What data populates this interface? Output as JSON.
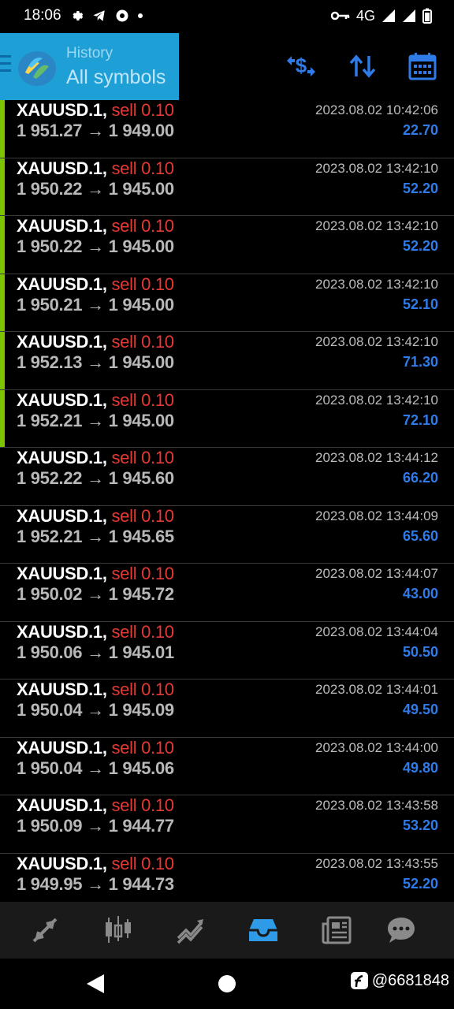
{
  "status_bar": {
    "time": "18:06",
    "network": "4G",
    "icons": [
      "gear-icon",
      "telegram-icon",
      "app-icon",
      "dot-icon",
      "key-icon",
      "signal-icon",
      "battery-icon"
    ]
  },
  "header": {
    "title": "History",
    "subtitle": "All symbols",
    "accent_color": "#1e9fd6"
  },
  "toolbar": {
    "buttons": [
      "currency-exchange-icon",
      "sort-icon",
      "calendar-icon"
    ],
    "icon_color": "#2f7be8"
  },
  "trades": [
    {
      "symbol": "XAUUSD.1,",
      "type": "sell 0.10",
      "open": "1 951.27",
      "close": "1 949.00",
      "time": "2023.08.02 10:42:06",
      "profit": "22.70",
      "accent": true
    },
    {
      "symbol": "XAUUSD.1,",
      "type": "sell 0.10",
      "open": "1 950.22",
      "close": "1 945.00",
      "time": "2023.08.02 13:42:10",
      "profit": "52.20",
      "accent": true
    },
    {
      "symbol": "XAUUSD.1,",
      "type": "sell 0.10",
      "open": "1 950.22",
      "close": "1 945.00",
      "time": "2023.08.02 13:42:10",
      "profit": "52.20",
      "accent": true
    },
    {
      "symbol": "XAUUSD.1,",
      "type": "sell 0.10",
      "open": "1 950.21",
      "close": "1 945.00",
      "time": "2023.08.02 13:42:10",
      "profit": "52.10",
      "accent": true
    },
    {
      "symbol": "XAUUSD.1,",
      "type": "sell 0.10",
      "open": "1 952.13",
      "close": "1 945.00",
      "time": "2023.08.02 13:42:10",
      "profit": "71.30",
      "accent": true
    },
    {
      "symbol": "XAUUSD.1,",
      "type": "sell 0.10",
      "open": "1 952.21",
      "close": "1 945.00",
      "time": "2023.08.02 13:42:10",
      "profit": "72.10",
      "accent": true
    },
    {
      "symbol": "XAUUSD.1,",
      "type": "sell 0.10",
      "open": "1 952.22",
      "close": "1 945.60",
      "time": "2023.08.02 13:44:12",
      "profit": "66.20",
      "accent": false
    },
    {
      "symbol": "XAUUSD.1,",
      "type": "sell 0.10",
      "open": "1 952.21",
      "close": "1 945.65",
      "time": "2023.08.02 13:44:09",
      "profit": "65.60",
      "accent": false
    },
    {
      "symbol": "XAUUSD.1,",
      "type": "sell 0.10",
      "open": "1 950.02",
      "close": "1 945.72",
      "time": "2023.08.02 13:44:07",
      "profit": "43.00",
      "accent": false
    },
    {
      "symbol": "XAUUSD.1,",
      "type": "sell 0.10",
      "open": "1 950.06",
      "close": "1 945.01",
      "time": "2023.08.02 13:44:04",
      "profit": "50.50",
      "accent": false
    },
    {
      "symbol": "XAUUSD.1,",
      "type": "sell 0.10",
      "open": "1 950.04",
      "close": "1 945.09",
      "time": "2023.08.02 13:44:01",
      "profit": "49.50",
      "accent": false
    },
    {
      "symbol": "XAUUSD.1,",
      "type": "sell 0.10",
      "open": "1 950.04",
      "close": "1 945.06",
      "time": "2023.08.02 13:44:00",
      "profit": "49.80",
      "accent": false
    },
    {
      "symbol": "XAUUSD.1,",
      "type": "sell 0.10",
      "open": "1 950.09",
      "close": "1 944.77",
      "time": "2023.08.02 13:43:58",
      "profit": "53.20",
      "accent": false
    },
    {
      "symbol": "XAUUSD.1,",
      "type": "sell 0.10",
      "open": "1 949.95",
      "close": "1 944.73",
      "time": "2023.08.02 13:43:55",
      "profit": "52.20",
      "accent": false
    }
  ],
  "arrow": "→",
  "colors": {
    "sell": "#e53935",
    "profit": "#2f7be8",
    "accent_bar": "#7cc300",
    "active_nav": "#2f9be8"
  },
  "bottom_nav": {
    "items": [
      "quotes-icon",
      "chart-icon",
      "trade-icon",
      "history-icon",
      "news-icon",
      "chat-icon"
    ],
    "active": "history-icon"
  },
  "system_nav": {
    "watermark": "@6681848"
  }
}
